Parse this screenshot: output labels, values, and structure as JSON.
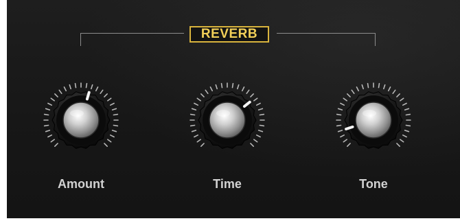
{
  "module": {
    "title": "REVERB",
    "title_color": "#f2cf58",
    "background": "#171717"
  },
  "knobs": [
    {
      "label": "Amount",
      "value_fraction": 0.56
    },
    {
      "label": "Time",
      "value_fraction": 0.69
    },
    {
      "label": "Tone",
      "value_fraction": 0.1
    }
  ]
}
